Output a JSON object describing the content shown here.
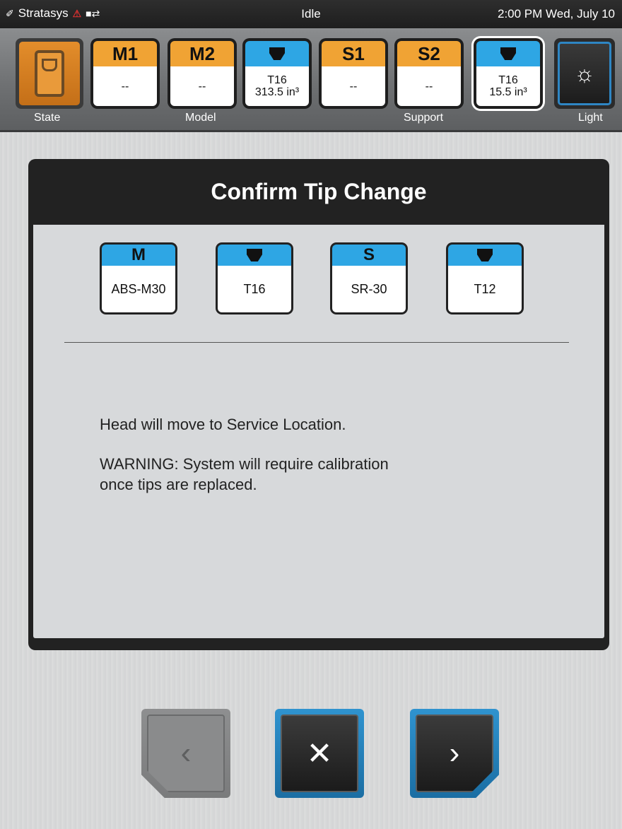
{
  "status_bar": {
    "brand": "Stratasys",
    "state": "Idle",
    "datetime": "2:00 PM Wed, July 10"
  },
  "toolbar": {
    "state_label": "State",
    "model_label": "Model",
    "support_label": "Support",
    "light_label": "Light",
    "bays": [
      {
        "header": "M1",
        "value": "--",
        "color": "#f0a334"
      },
      {
        "header": "M2",
        "value": "--",
        "color": "#f0a334"
      },
      {
        "header_icon": "tip-icon",
        "line1": "T16",
        "line2": "313.5 in³",
        "color": "#2ea6e4"
      },
      {
        "header": "S1",
        "value": "--",
        "color": "#f0a334"
      },
      {
        "header": "S2",
        "value": "--",
        "color": "#f0a334"
      },
      {
        "header_icon": "tip-icon",
        "line1": "T16",
        "line2": "15.5 in³",
        "color": "#2ea6e4",
        "selected": true
      }
    ]
  },
  "dialog": {
    "title": "Confirm Tip Change",
    "cards": [
      {
        "header": "M",
        "value": "ABS-M30"
      },
      {
        "header_icon": "tip-icon",
        "value": "T16"
      },
      {
        "header": "S",
        "value": "SR-30"
      },
      {
        "header_icon": "tip-icon",
        "value": "T12"
      }
    ],
    "message": "Head will move to Service Location.",
    "warning_line1": "WARNING:  System will require calibration",
    "warning_line2": "once tips are replaced."
  },
  "nav": {
    "back_icon": "chevron-left-icon",
    "cancel_icon": "close-icon",
    "next_icon": "chevron-right-icon"
  },
  "colors": {
    "accent_blue": "#2ea6e4",
    "accent_orange": "#f0a334"
  }
}
